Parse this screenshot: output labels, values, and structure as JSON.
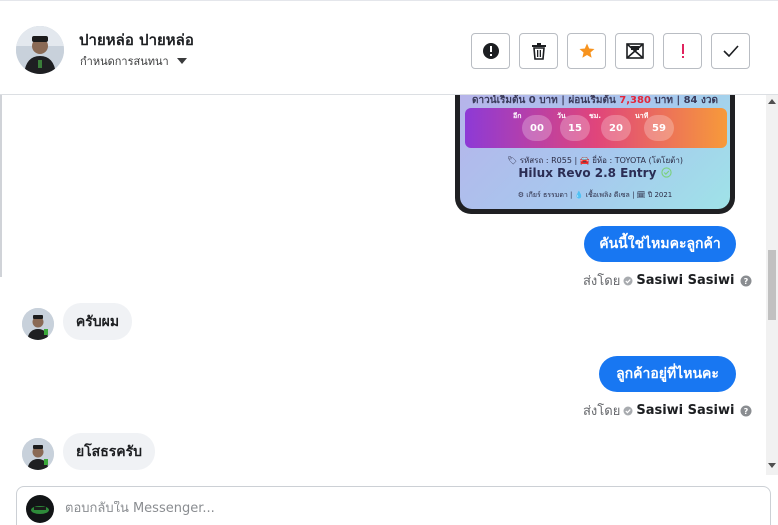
{
  "header": {
    "contact_name": "ปายหล่อ ปายหล่อ",
    "assign_label": "กำหนดการสนทนา",
    "toolbar": [
      {
        "icon": "alert-circle-icon",
        "name": "spam-button"
      },
      {
        "icon": "trash-icon",
        "name": "delete-button"
      },
      {
        "icon": "star-icon",
        "name": "star-button",
        "color": "#f7931e"
      },
      {
        "icon": "mail-unread-icon",
        "name": "mark-unread-button"
      },
      {
        "icon": "exclamation-icon",
        "name": "follow-up-button",
        "color": "#e0245e"
      },
      {
        "icon": "check-icon",
        "name": "mark-done-button"
      }
    ]
  },
  "product_card": {
    "finance_prefix": "ดาวน์เริ่มต้น 0 บาท | ผ่อนเริ่มต้น",
    "finance_amount": "7,380",
    "finance_suffix": "บาท | 84 งวด",
    "timer_labels": [
      "อีก",
      "วัน",
      "ชม.",
      "นาที"
    ],
    "timer_values": [
      "00",
      "15",
      "20",
      "59"
    ],
    "meta": "🏷 รหัสรถ : R055 | 🚘 ยี่ห้อ : TOYOTA (โตโยต้า)",
    "car_name": "Hilux Revo 2.8 Entry",
    "specs": "⚙ เกียร์ ธรรมดา | 💧 เชื้อเพลิง ดีเซล | 🗓 ปี 2021"
  },
  "messages": [
    {
      "direction": "out",
      "text": "คันนี้ใช่ไหมคะลูกค้า",
      "sent_by_label": "ส่งโดย",
      "sender": "Sasiwi Sasiwi"
    },
    {
      "direction": "in",
      "text": "ครับผม"
    },
    {
      "direction": "out",
      "text": "ลูกค้าอยู่ที่ไหนคะ",
      "sent_by_label": "ส่งโดย",
      "sender": "Sasiwi Sasiwi"
    },
    {
      "direction": "in",
      "text": "ยโสธรครับ"
    }
  ],
  "composer": {
    "placeholder": "ตอบกลับใน Messenger..."
  },
  "colors": {
    "accent": "#1877f2",
    "bubble_in": "#f0f2f5",
    "star": "#f7931e",
    "follow_up": "#e0245e"
  }
}
